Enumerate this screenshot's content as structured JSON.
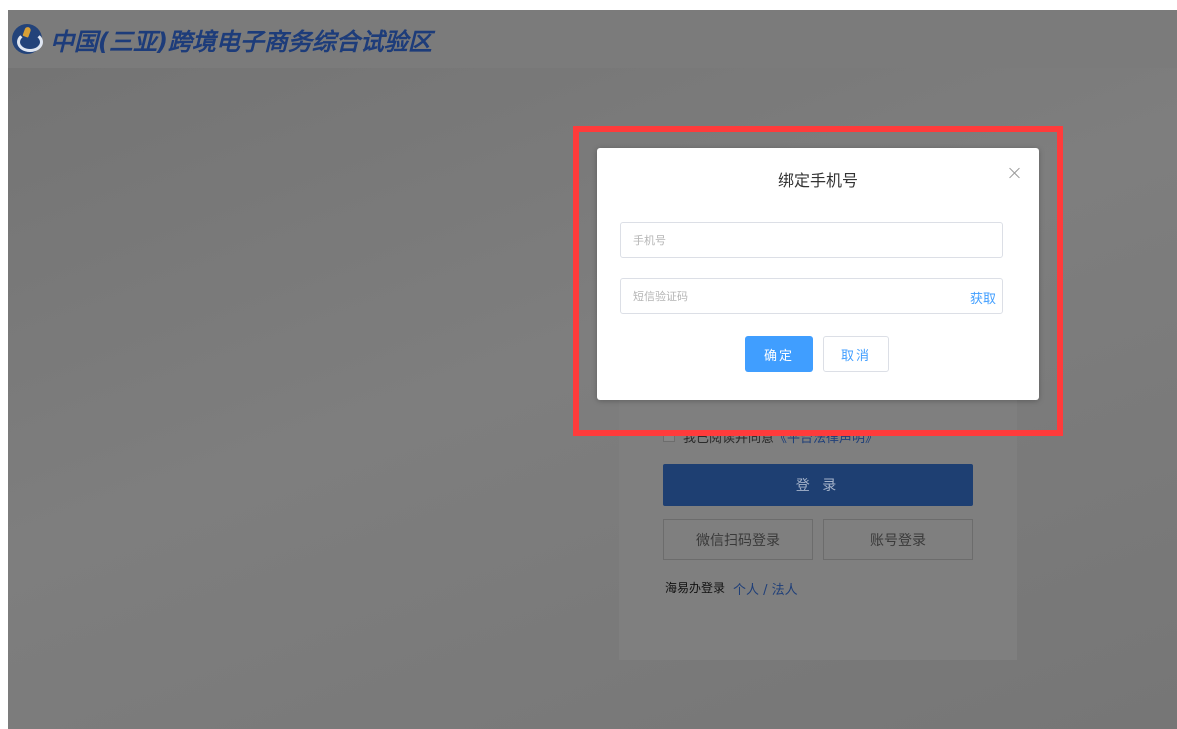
{
  "header": {
    "title": "中国(三亚)跨境电子商务综合试验区",
    "logo_icon": "globe-logo-icon"
  },
  "login_card": {
    "agreement_text": "我已阅读并同意",
    "agreement_link": "《平台法律声明》",
    "login_label": "登 录",
    "wechat_login_label": "微信扫码登录",
    "account_login_label": "账号登录",
    "haiyiban_label": "海易办登录",
    "haiyiban_link": "个人 / 法人"
  },
  "dialog": {
    "title": "绑定手机号",
    "close_icon": "close-icon",
    "phone_placeholder": "手机号",
    "sms_placeholder": "短信验证码",
    "get_code_label": "获取",
    "confirm_label": "确定",
    "cancel_label": "取消"
  },
  "colors": {
    "highlight": "#ff3b3b",
    "primary": "#409eff",
    "overlay_gray": "#7c7c7c"
  }
}
